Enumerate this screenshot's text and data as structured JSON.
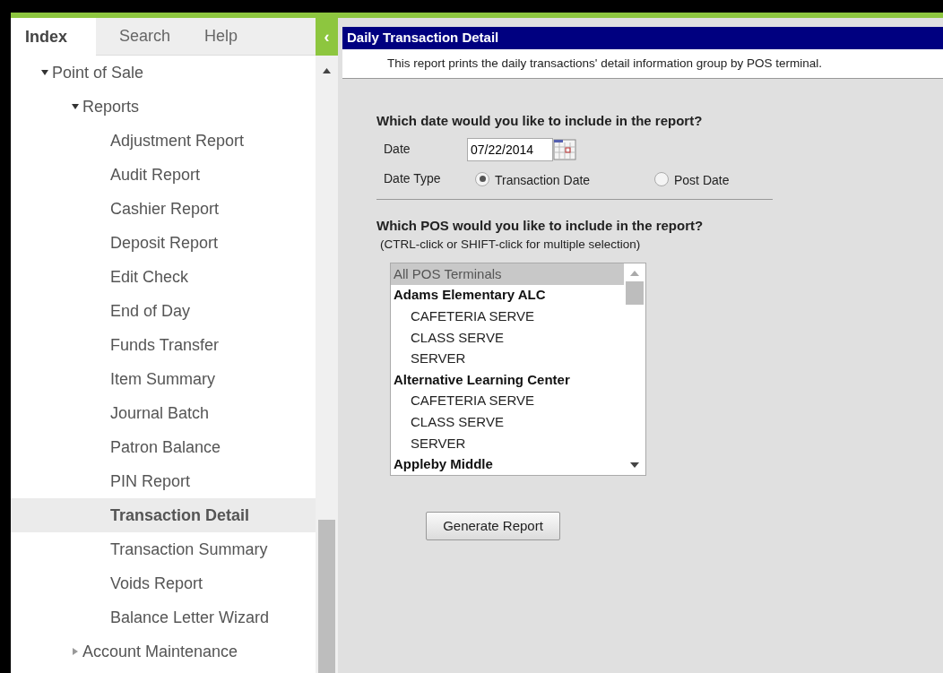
{
  "tabs": [
    {
      "label": "Index",
      "selected": true
    },
    {
      "label": "Search",
      "selected": false
    },
    {
      "label": "Help",
      "selected": false
    }
  ],
  "collapse_button": {
    "label": "‹"
  },
  "tree": [
    {
      "label": "Point of Sale",
      "expanded": true,
      "selected": false,
      "children": [
        {
          "label": "Reports",
          "expanded": true,
          "selected": false,
          "children": [
            {
              "label": "Adjustment Report",
              "selected": false
            },
            {
              "label": "Audit Report",
              "selected": false
            },
            {
              "label": "Cashier Report",
              "selected": false
            },
            {
              "label": "Deposit Report",
              "selected": false
            },
            {
              "label": "Edit Check",
              "selected": false
            },
            {
              "label": "End of Day",
              "selected": false
            },
            {
              "label": "Funds Transfer",
              "selected": false
            },
            {
              "label": "Item Summary",
              "selected": false
            },
            {
              "label": "Journal Batch",
              "selected": false
            },
            {
              "label": "Patron Balance",
              "selected": false
            },
            {
              "label": "PIN Report",
              "selected": false
            },
            {
              "label": "Transaction Detail",
              "selected": true
            },
            {
              "label": "Transaction Summary",
              "selected": false
            },
            {
              "label": "Voids Report",
              "selected": false
            },
            {
              "label": "Balance Letter Wizard",
              "selected": false
            }
          ]
        },
        {
          "label": "Account Maintenance",
          "expanded": false,
          "selected": false
        }
      ]
    }
  ],
  "report": {
    "title": "Daily Transaction Detail",
    "description": "This report prints the daily transactions' detail information group by POS terminal.",
    "date_question": "Which date would you like to include in the report?",
    "date_label": "Date",
    "date_value": "07/22/2014",
    "date_type_label": "Date Type",
    "date_types": [
      {
        "label": "Transaction Date",
        "selected": true
      },
      {
        "label": "Post Date",
        "selected": false
      }
    ],
    "pos_question": "Which POS would you like to include in the report?",
    "pos_hint": "(CTRL-click or SHIFT-click for multiple selection)",
    "pos_list": [
      {
        "kind": "all",
        "label": "All POS Terminals",
        "selected": true
      },
      {
        "kind": "group",
        "label": "Adams Elementary ALC",
        "selected": false
      },
      {
        "kind": "terminal",
        "label": "CAFETERIA SERVE",
        "selected": false
      },
      {
        "kind": "terminal",
        "label": "CLASS SERVE",
        "selected": false
      },
      {
        "kind": "terminal",
        "label": "SERVER",
        "selected": false
      },
      {
        "kind": "group",
        "label": "Alternative Learning Center",
        "selected": false
      },
      {
        "kind": "terminal",
        "label": "CAFETERIA SERVE",
        "selected": false
      },
      {
        "kind": "terminal",
        "label": "CLASS SERVE",
        "selected": false
      },
      {
        "kind": "terminal",
        "label": "SERVER",
        "selected": false
      },
      {
        "kind": "group",
        "label": "Appleby Middle",
        "selected": false
      }
    ],
    "generate_button": "Generate Report"
  }
}
